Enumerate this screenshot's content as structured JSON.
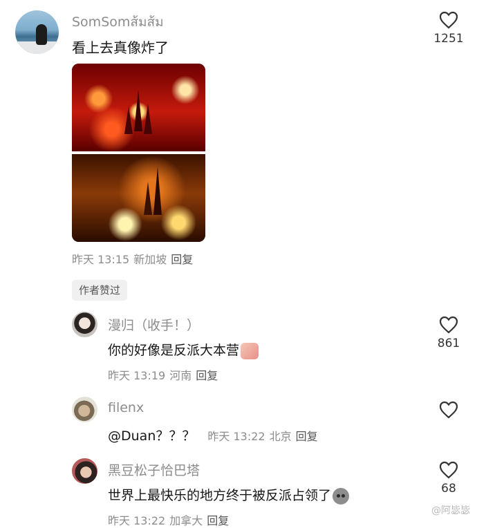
{
  "main_comment": {
    "username": "SomSomส้มส้ม",
    "text": "看上去真像炸了",
    "likes": "1251",
    "time": "昨天 13:15",
    "location": "新加坡",
    "reply_label": "回复",
    "author_liked_label": "作者赞过"
  },
  "replies": [
    {
      "username": "漫归（收手！）",
      "text": "你的好像是反派大本营",
      "emoji": "waving-hand-sticker",
      "likes": "861",
      "time": "昨天 13:19",
      "location": "河南",
      "reply_label": "回复"
    },
    {
      "username": "filenx",
      "text": "@Duan？？？",
      "time": "昨天 13:22",
      "location": "北京",
      "reply_label": "回复"
    },
    {
      "username": "黑豆松子恰巴塔",
      "text": "世界上最快乐的地方终于被反派占领了",
      "emoji": "gray-face-emoji",
      "likes": "68",
      "time": "昨天 13:22",
      "location": "加拿大",
      "reply_label": "回复"
    }
  ],
  "watermark": "@阿毖毖",
  "colors": {
    "text": "#171717",
    "muted": "#8c8c8c",
    "chip_bg": "#f0f0f0"
  }
}
